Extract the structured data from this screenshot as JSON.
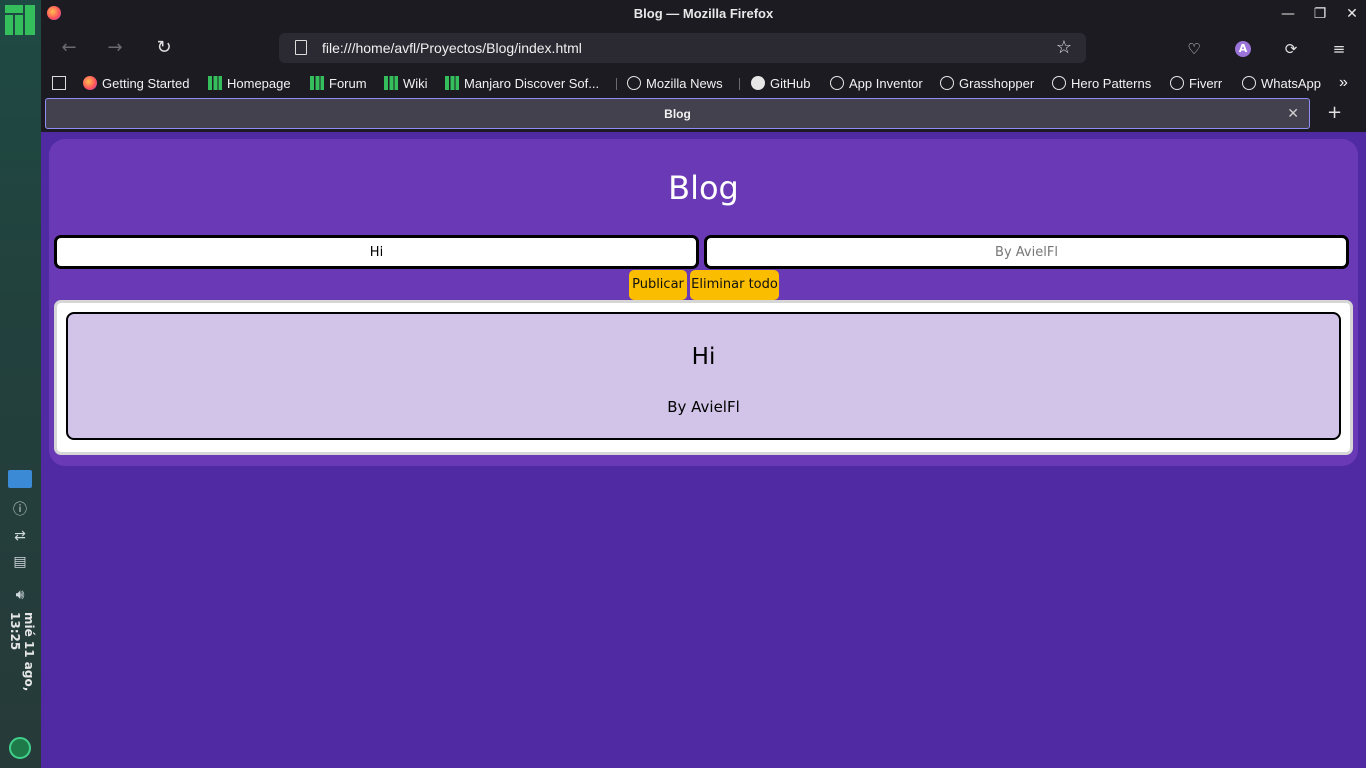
{
  "desktop": {
    "clock": "mié 11 ago, 13:25"
  },
  "window": {
    "title": "Blog — Mozilla Firefox"
  },
  "navbar": {
    "url": "file:///home/avfl/Proyectos/Blog/index.html",
    "avatar_letter": "A"
  },
  "bookmarks": [
    {
      "label": "Getting Started",
      "icon": "firefox-icon"
    },
    {
      "label": "Homepage",
      "icon": "manjaro-icon"
    },
    {
      "label": "Forum",
      "icon": "manjaro-icon"
    },
    {
      "label": "Wiki",
      "icon": "manjaro-icon"
    },
    {
      "label": "Manjaro Discover Sof...",
      "icon": "manjaro-icon"
    },
    {
      "label": "Mozilla News",
      "icon": "globe-icon"
    },
    {
      "label": "GitHub",
      "icon": "github-icon"
    },
    {
      "label": "App Inventor",
      "icon": "globe-icon"
    },
    {
      "label": "Grasshopper",
      "icon": "globe-icon"
    },
    {
      "label": "Hero Patterns",
      "icon": "globe-icon"
    },
    {
      "label": "Fiverr",
      "icon": "globe-icon"
    },
    {
      "label": "WhatsApp",
      "icon": "globe-icon"
    }
  ],
  "tab": {
    "title": "Blog"
  },
  "page": {
    "title": "Blog",
    "title_input_value": "Hi",
    "author_input_placeholder": "By AvielFl",
    "publish_label": "Publicar",
    "delete_all_label": "Eliminar todo",
    "posts": [
      {
        "title": "Hi",
        "author": "By AvielFl"
      }
    ]
  },
  "colors": {
    "page_bg": "#4f2aa3",
    "panel_bg": "#6a39b6",
    "button_bg": "#fbbd00",
    "post_bg": "#d1c4e8"
  }
}
